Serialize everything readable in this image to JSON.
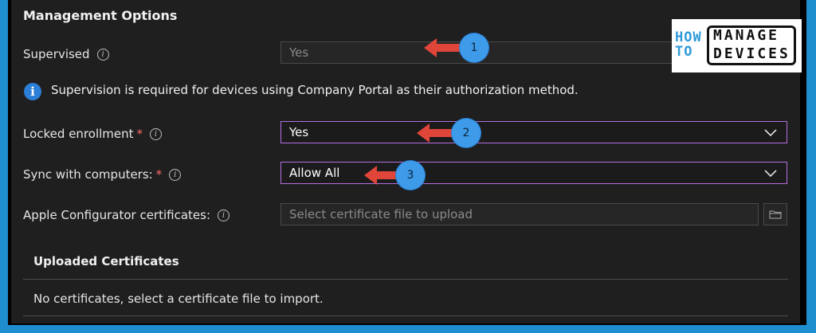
{
  "section": {
    "title": "Management Options"
  },
  "supervised": {
    "label": "Supervised",
    "value": "Yes"
  },
  "banner": {
    "text": "Supervision is required for devices using Company Portal as their authorization method."
  },
  "locked": {
    "label": "Locked enrollment",
    "required": "*",
    "value": "Yes"
  },
  "sync": {
    "label": "Sync with computers:",
    "required": "*",
    "value": "Allow All"
  },
  "apple": {
    "label": "Apple Configurator certificates:",
    "placeholder": "Select certificate file to upload"
  },
  "uploaded": {
    "heading": "Uploaded Certificates",
    "empty": "No certificates, select a certificate file to import."
  },
  "annotations": [
    {
      "num": "1"
    },
    {
      "num": "2"
    },
    {
      "num": "3"
    }
  ],
  "logo": {
    "how": "HOW",
    "to": "TO",
    "manage": "MANAGE",
    "devices": "DEVICES"
  },
  "colors": {
    "accent": "#b46ee0",
    "info": "#2b7fd6",
    "arrow": "#e0453a",
    "badge": "#3d9be9",
    "border": "#1e8ecf"
  }
}
